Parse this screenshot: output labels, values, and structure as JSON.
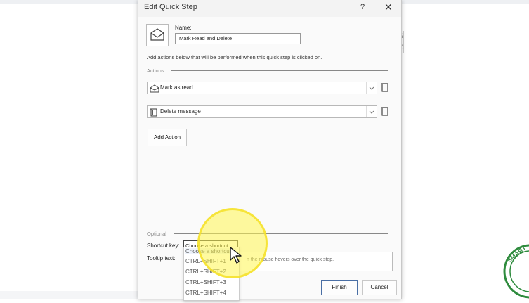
{
  "dialog": {
    "title": "Edit Quick Step",
    "help_glyph": "?",
    "close_glyph": "✕",
    "name_label": "Name:",
    "name_value": "Mark Read and Delete",
    "description": "Add actions below that will be performed when this quick step is clicked on.",
    "actions_header": "Actions",
    "actions": [
      {
        "label": "Mark as read",
        "icon": "envelope-open-icon"
      },
      {
        "label": "Delete message",
        "icon": "trash-icon"
      }
    ],
    "add_action_label": "Add Action",
    "optional_header": "Optional",
    "shortcut_label": "Shortcut key:",
    "shortcut_value": "Choose a shortcut",
    "shortcut_options": [
      "Choose a shortcut",
      "CTRL+SHIFT+1",
      "CTRL+SHIFT+2",
      "CTRL+SHIFT+3",
      "CTRL+SHIFT+4"
    ],
    "tooltip_label": "Tooltip text:",
    "tooltip_hint": "n the mouse hovers over the quick step.",
    "finish_label": "Finish",
    "cancel_label": "Cancel"
  },
  "background": {
    "edge_letters": [
      "S",
      "C"
    ]
  },
  "colors": {
    "highlight": "#fff550",
    "badge": "#2e8b3d"
  }
}
